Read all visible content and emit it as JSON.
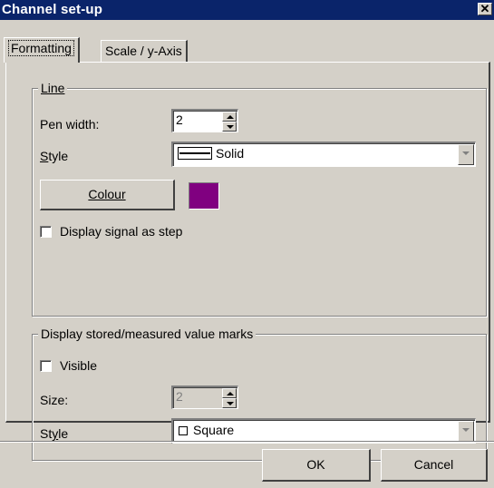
{
  "window": {
    "title": "Channel set-up",
    "close_glyph": "✕"
  },
  "tabs": [
    {
      "label": "Formatting",
      "active": true
    },
    {
      "label": "Scale / y-Axis",
      "active": false
    }
  ],
  "line_group": {
    "title": "Line",
    "pen_width": {
      "label": "Pen width:",
      "value": "2"
    },
    "style": {
      "label": "Style",
      "value": "Solid",
      "icon": "solid-line-icon"
    },
    "colour_button": "Colour",
    "colour_value": "#800080",
    "step_checkbox": {
      "label": "Display signal as step",
      "checked": false
    }
  },
  "marks_group": {
    "title": "Display stored/measured value marks",
    "visible_checkbox": {
      "label": "Visible",
      "checked": false
    },
    "size": {
      "label": "Size:",
      "value": "2"
    },
    "style": {
      "label": "Style",
      "value": "Square",
      "icon": "square-marker-icon"
    }
  },
  "footer": {
    "ok": "OK",
    "cancel": "Cancel"
  }
}
